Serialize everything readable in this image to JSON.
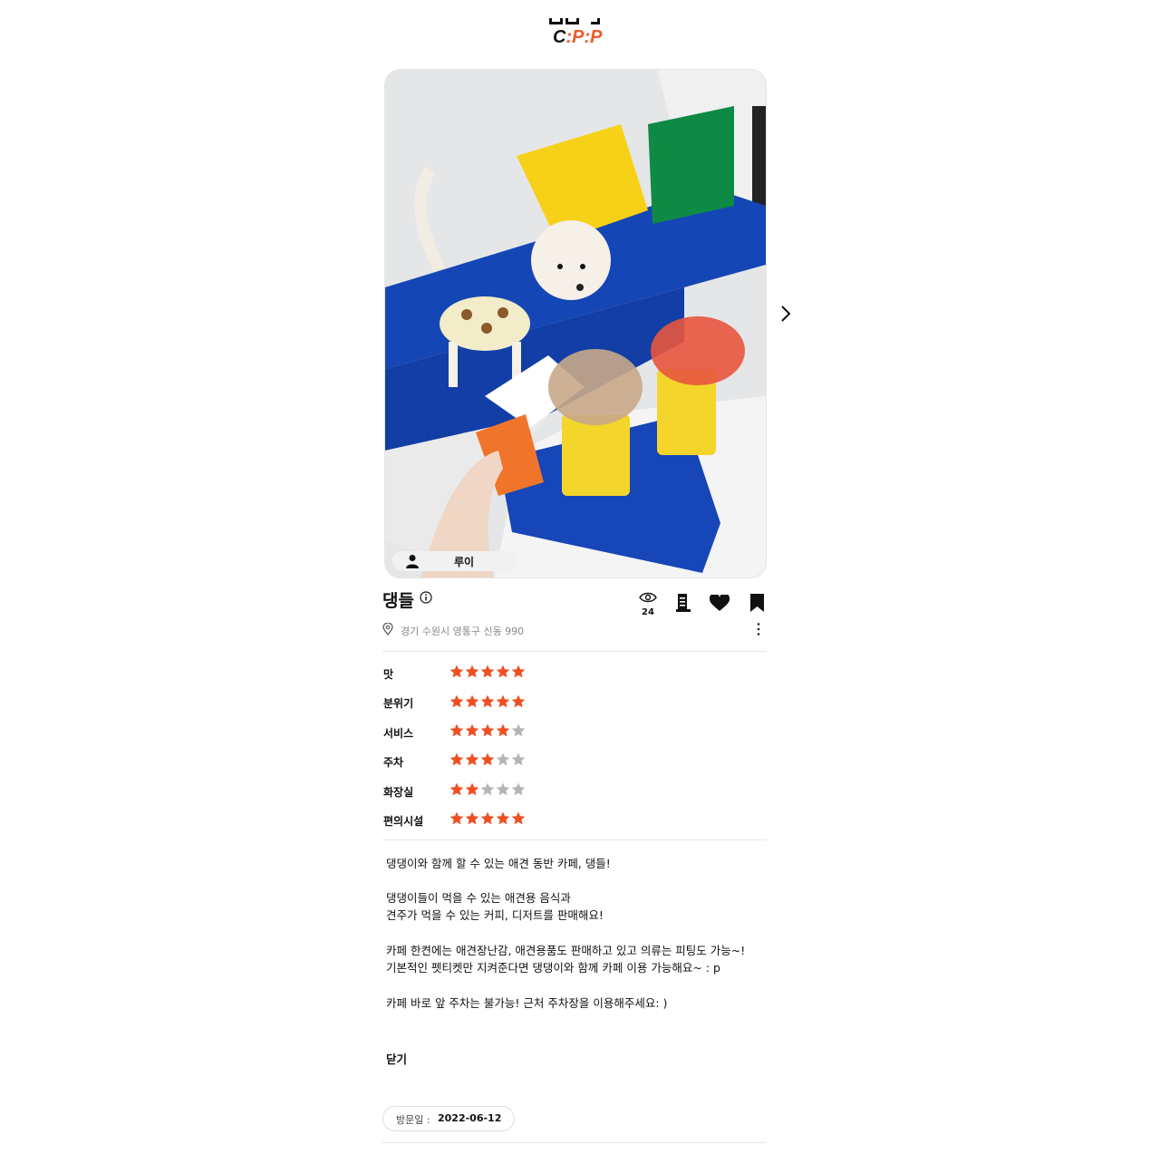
{
  "header": {
    "logo_text": "C:P:P",
    "logo_parts": [
      "C",
      ":P",
      ":P"
    ]
  },
  "post": {
    "author": "루이",
    "title": "댕들",
    "address": "경기 수원시 영통구 신동 990",
    "views": "24"
  },
  "ratings": [
    {
      "label": "맛",
      "score": 5
    },
    {
      "label": "분위기",
      "score": 5
    },
    {
      "label": "서비스",
      "score": 4
    },
    {
      "label": "주차",
      "score": 3
    },
    {
      "label": "화장실",
      "score": 2
    },
    {
      "label": "편의시설",
      "score": 5
    }
  ],
  "ratings_max": 5,
  "description": [
    "댕댕이와 함께 할 수 있는 애견 동반 카페, 댕들!",
    "",
    "댕댕이들이 먹을 수 있는 애견용 음식과",
    "견주가 먹을 수 있는 커피, 디저트를 판매해요!",
    "",
    "카페 한켠에는 애견장난감, 애견용품도 판매하고 있고 의류는 피팅도 가능~!",
    "기본적인 펫티켓만 지켜준다면 댕댕이와 함께 카페 이용 가능해요~ : p",
    "",
    "카페 바로 앞 주차는 불가능! 근처 주차장을 이용해주세요: )"
  ],
  "close_label": "닫기",
  "visit": {
    "label": "방문일 :",
    "date": "2022-06-12"
  },
  "colors": {
    "accent": "#f05a28",
    "star_on": "#f04e23",
    "star_off": "#b5b5b5"
  },
  "icons": [
    "eye-icon",
    "receipt-icon",
    "heart-icon",
    "bookmark-icon",
    "more-vertical-icon",
    "info-icon",
    "location-pin-icon",
    "person-icon",
    "chevron-right-icon"
  ]
}
